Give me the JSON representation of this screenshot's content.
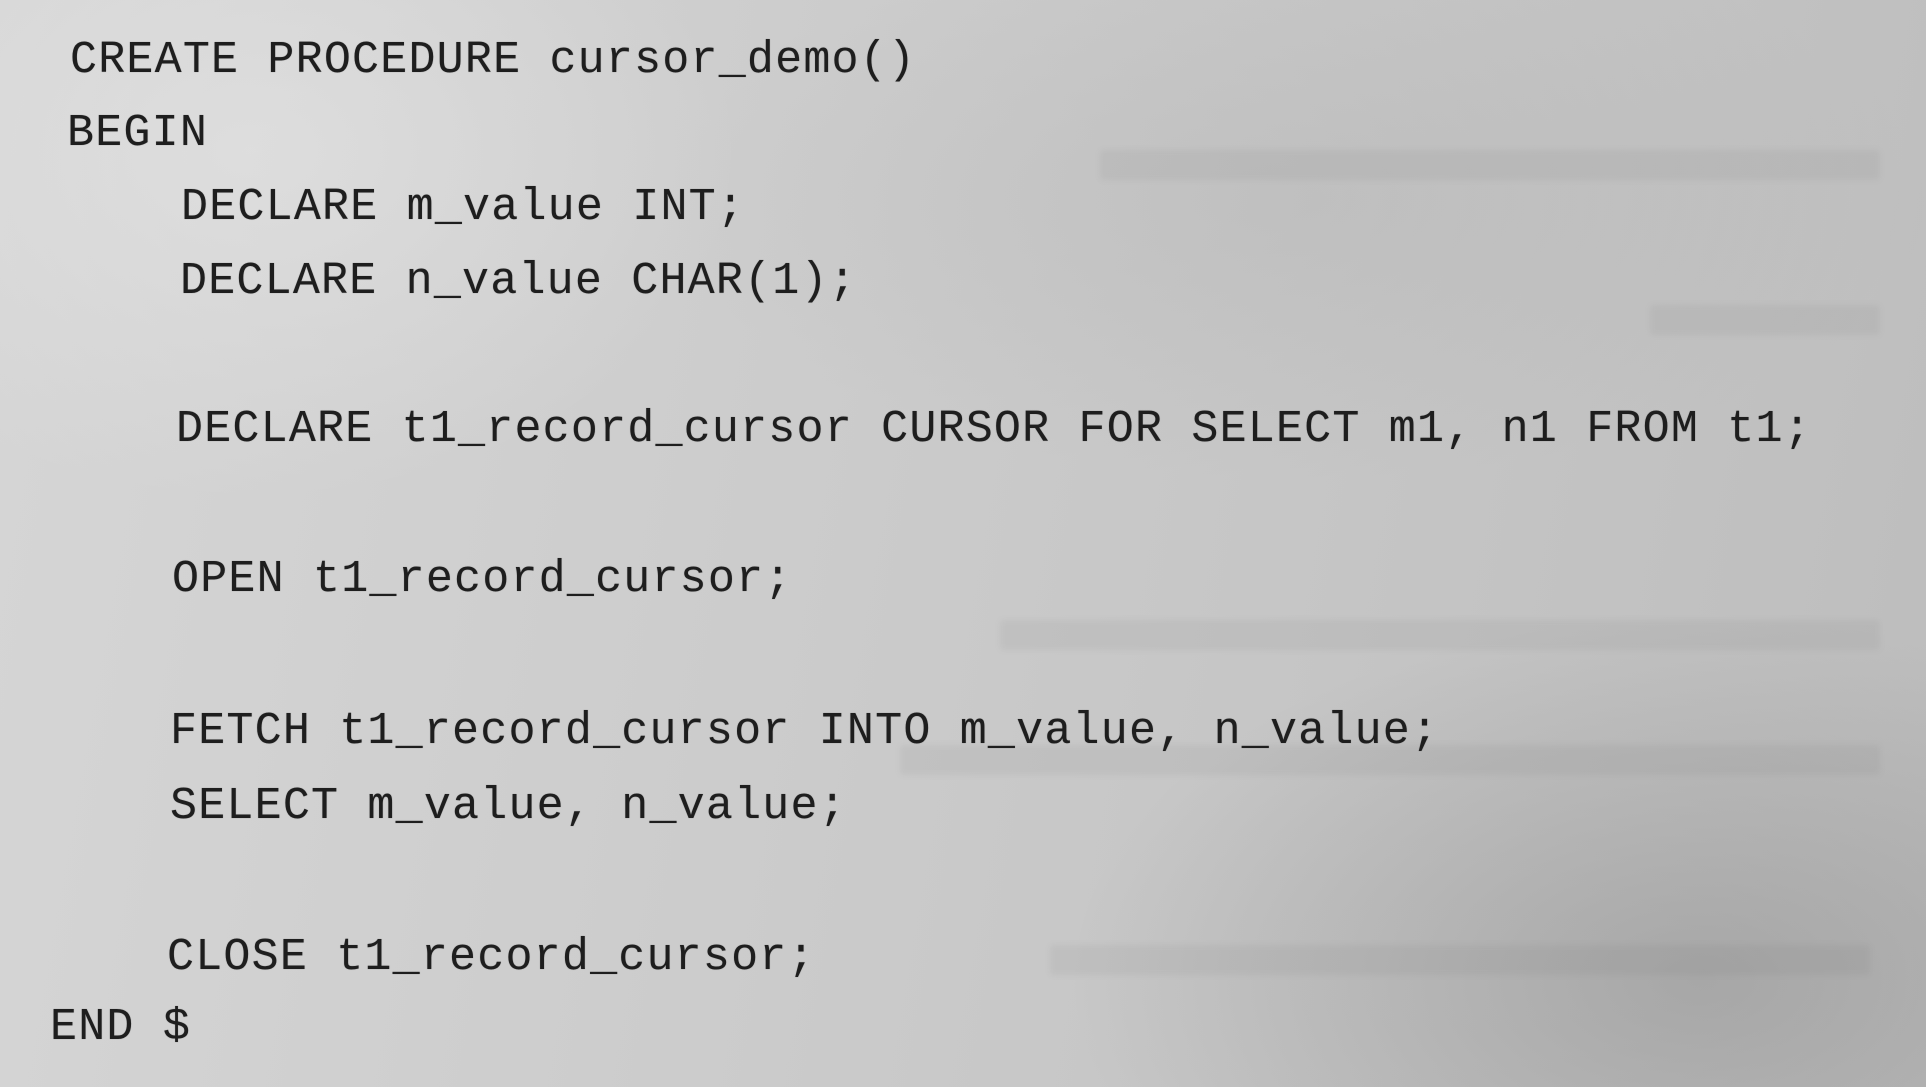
{
  "code_lines": [
    "CREATE PROCEDURE cursor_demo()",
    "BEGIN",
    "DECLARE m_value INT;",
    "DECLARE n_value CHAR(1);",
    "DECLARE t1_record_cursor CURSOR FOR SELECT m1, n1 FROM t1;",
    "OPEN t1_record_cursor;",
    "FETCH t1_record_cursor INTO m_value, n_value;",
    "SELECT m_value, n_value;",
    "CLOSE t1_record_cursor;",
    "END $"
  ]
}
